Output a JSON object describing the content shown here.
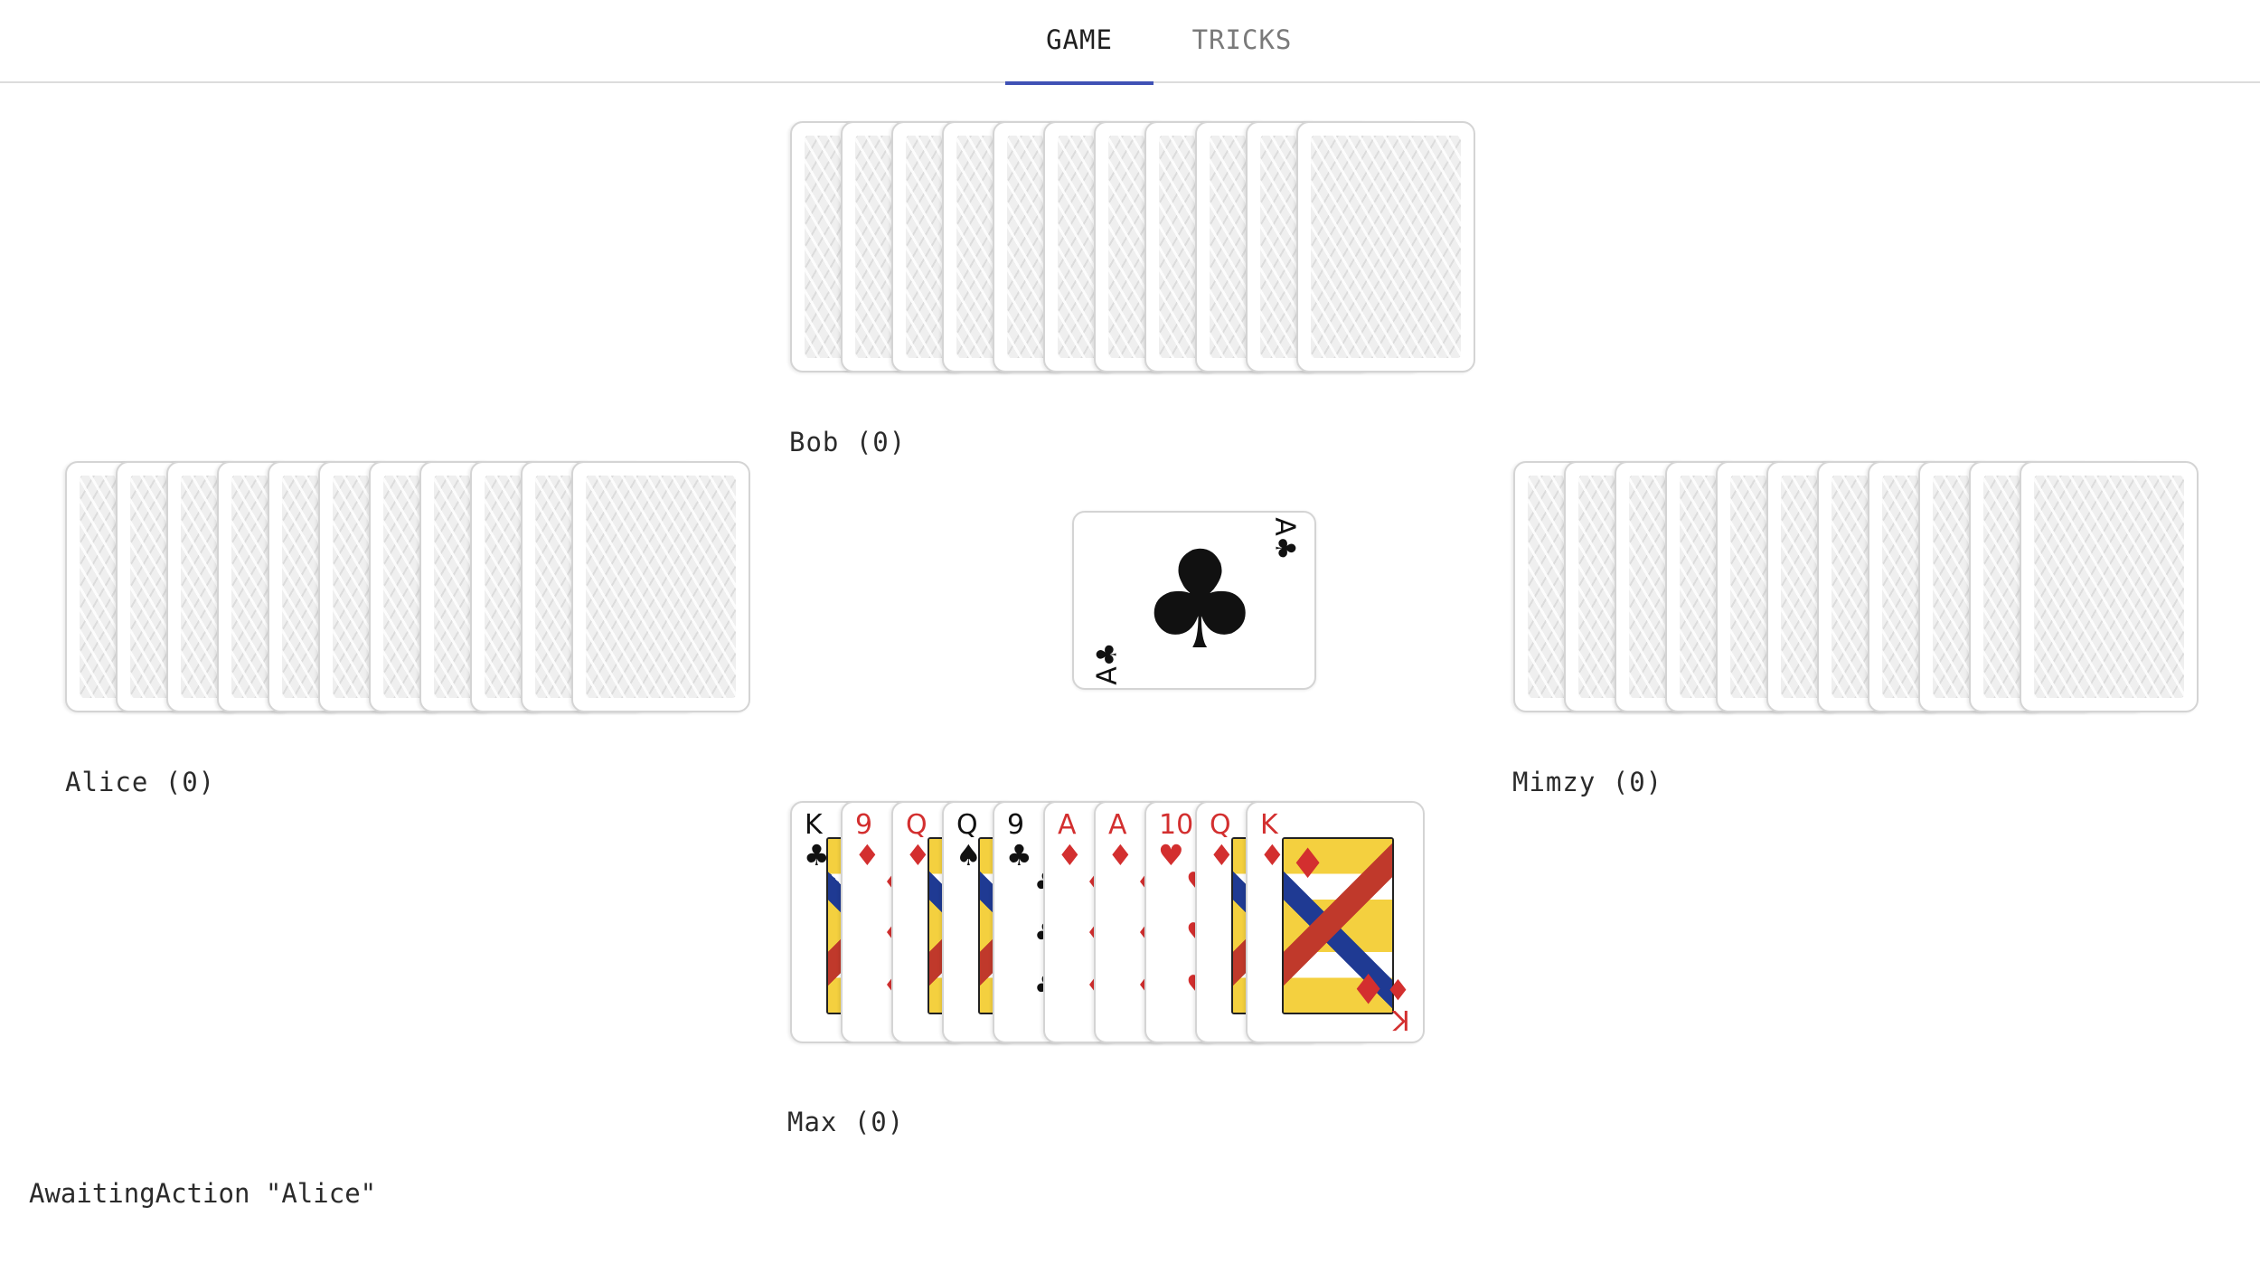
{
  "tabs": [
    {
      "label": "GAME",
      "active": true
    },
    {
      "label": "TRICKS",
      "active": false
    }
  ],
  "players": {
    "north": {
      "label": "Bob (0)",
      "card_count": 11
    },
    "west": {
      "label": "Alice (0)",
      "card_count": 11
    },
    "east": {
      "label": "Mimzy (0)",
      "card_count": 11
    },
    "south": {
      "label": "Max (0)"
    }
  },
  "hand": [
    {
      "rank": "K",
      "suit": "♣",
      "color": "black",
      "court": true
    },
    {
      "rank": "9",
      "suit": "♦",
      "color": "red",
      "court": false
    },
    {
      "rank": "Q",
      "suit": "♦",
      "color": "red",
      "court": true
    },
    {
      "rank": "Q",
      "suit": "♠",
      "color": "black",
      "court": true
    },
    {
      "rank": "9",
      "suit": "♣",
      "color": "black",
      "court": false
    },
    {
      "rank": "A",
      "suit": "♦",
      "color": "red",
      "court": false
    },
    {
      "rank": "A",
      "suit": "♦",
      "color": "red",
      "court": false
    },
    {
      "rank": "10",
      "suit": "♥",
      "color": "red",
      "court": false
    },
    {
      "rank": "Q",
      "suit": "♦",
      "color": "red",
      "court": true
    },
    {
      "rank": "K",
      "suit": "♦",
      "color": "red",
      "court": true
    }
  ],
  "trick": {
    "rank": "A",
    "suit": "♣",
    "color": "black"
  },
  "status": "AwaitingAction \"Alice\"",
  "colors": {
    "accent": "#3f51b5",
    "red_suit": "#d32f2f",
    "black_suit": "#111111"
  }
}
